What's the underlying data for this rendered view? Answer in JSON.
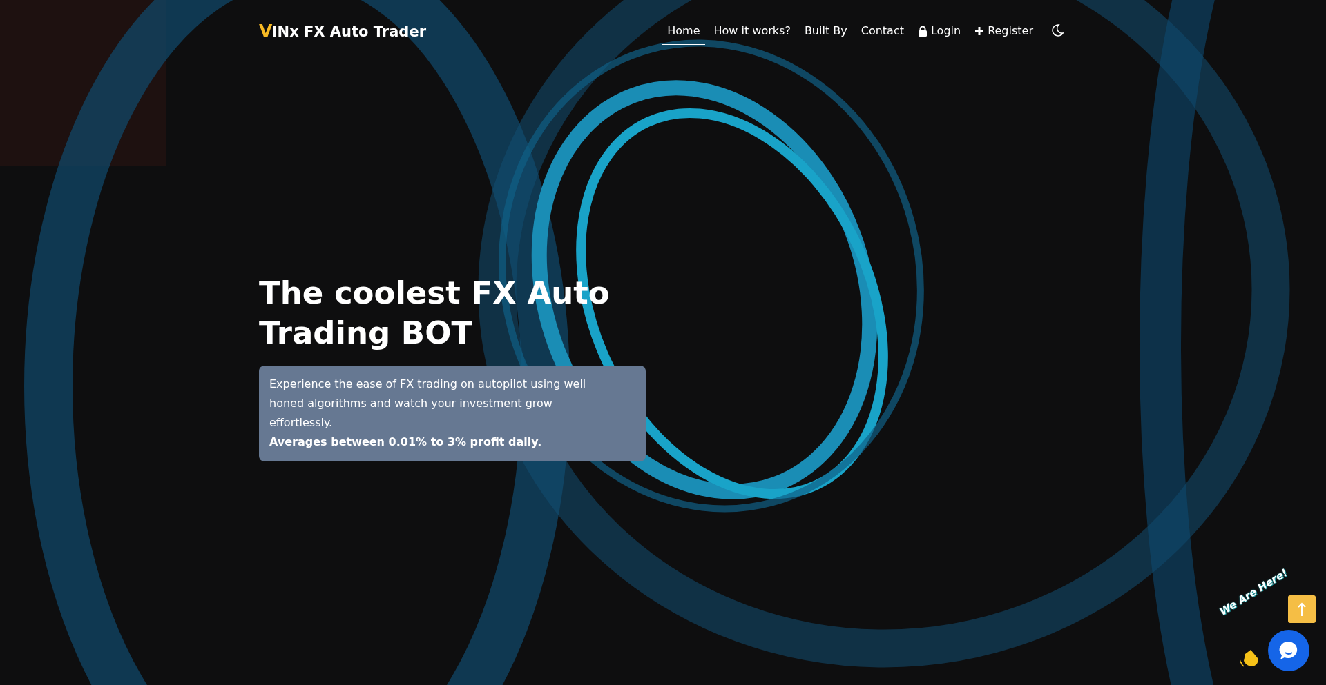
{
  "brand": {
    "mark": "V",
    "name": "iNx FX Auto Trader"
  },
  "nav": [
    {
      "label": "Home",
      "selected": true,
      "kind": "text"
    },
    {
      "label": "How it works?",
      "selected": false,
      "kind": "text"
    },
    {
      "label": "Built By",
      "selected": false,
      "kind": "text"
    },
    {
      "label": "Contact",
      "selected": false,
      "kind": "text"
    },
    {
      "label": "Login",
      "selected": false,
      "kind": "lock"
    },
    {
      "label": "Register",
      "selected": false,
      "kind": "plus"
    }
  ],
  "hero": {
    "title": "The coolest FX Auto Trading BOT",
    "description": "Experience the ease of FX trading on autopilot using well honed algorithms and watch your investment grow effortlessly.",
    "highlight": "Averages between 0.01% to 3% profit daily."
  },
  "chat_widget": {
    "greeting": "We Are Here!"
  }
}
